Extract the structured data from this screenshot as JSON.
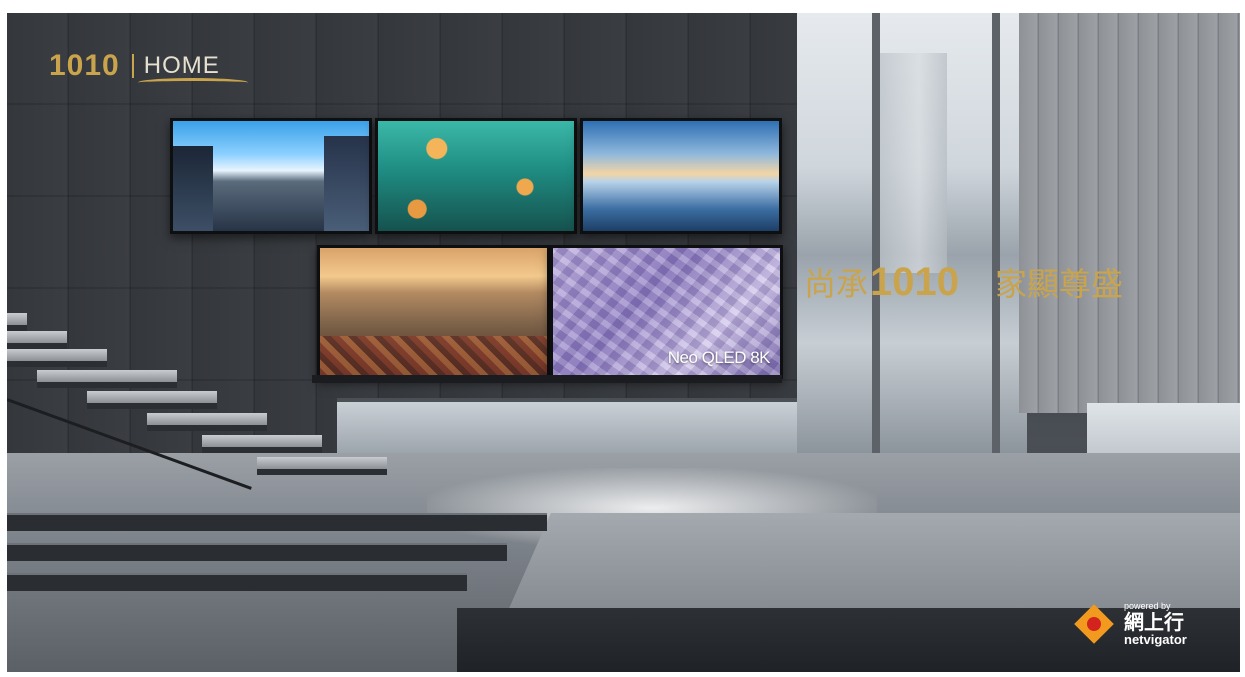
{
  "brand": {
    "logo_mark": "1010",
    "logo_word": "HOME",
    "accent_color": "#c9a44c"
  },
  "headline": {
    "prefix": "尚承",
    "number": "1010",
    "suffix": "家顯尊盛"
  },
  "screens": {
    "qled_label": "Neo QLED 8K"
  },
  "partner": {
    "powered_by": "powered by",
    "name_cn": "網上行",
    "name_en": "netvigator",
    "icon": "netvigator-logo-icon"
  }
}
